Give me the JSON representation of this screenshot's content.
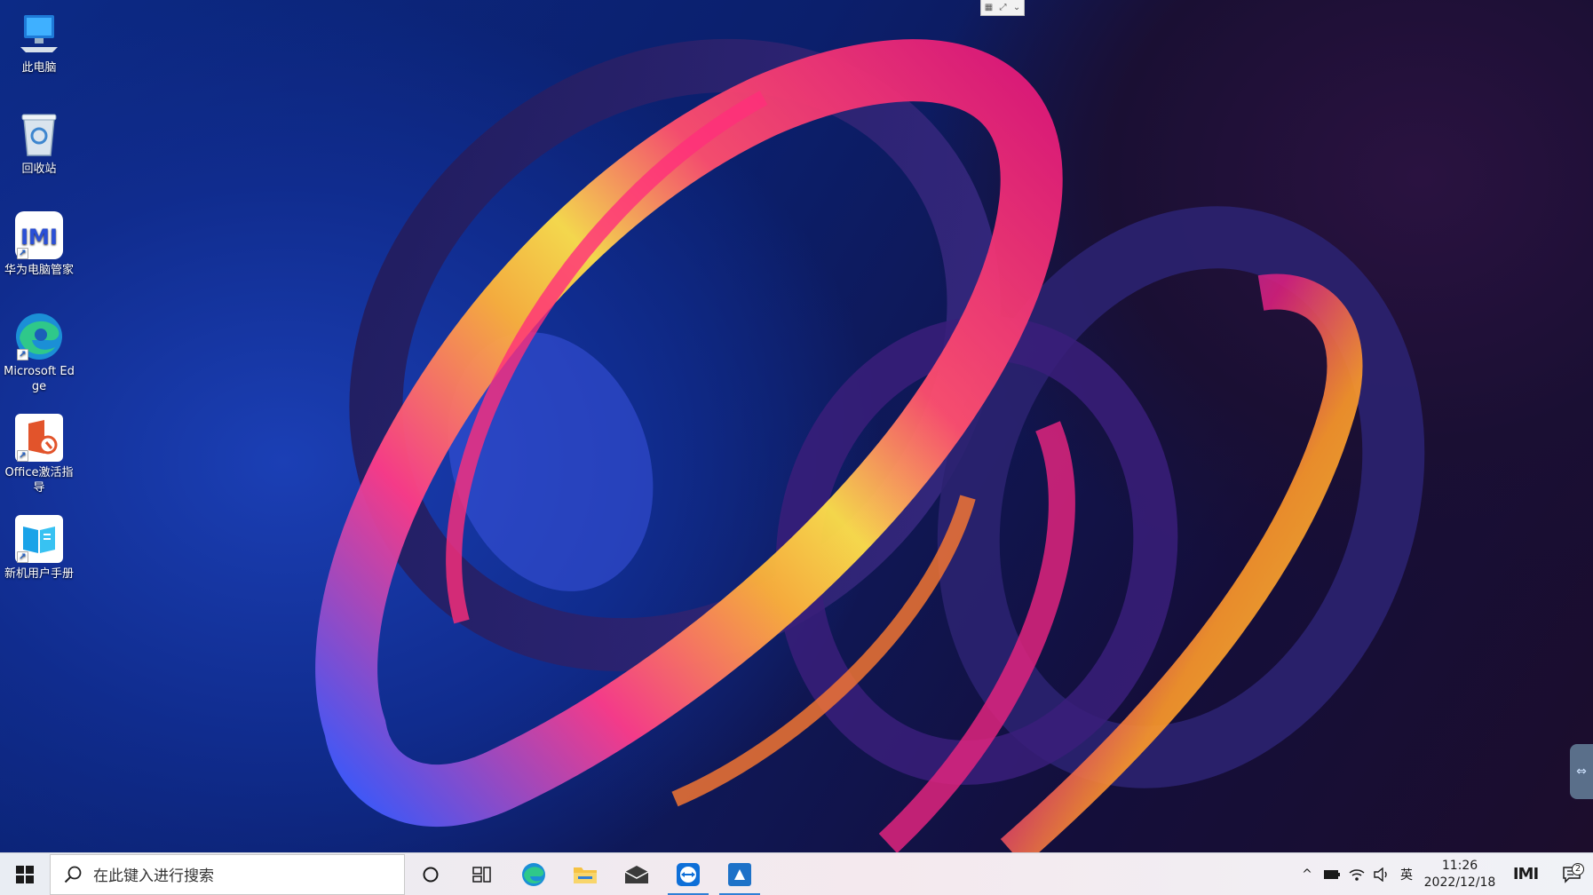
{
  "desktop": {
    "icons": [
      {
        "label": "此电脑",
        "icon": "computer-icon"
      },
      {
        "label": "回收站",
        "icon": "recycle-bin-icon"
      },
      {
        "label": "华为电脑管家",
        "icon": "huawei-pc-manager-icon"
      },
      {
        "label": "Microsoft Edge",
        "icon": "edge-icon"
      },
      {
        "label": "Office激活指导",
        "icon": "office-activation-icon"
      },
      {
        "label": "新机用户手册",
        "icon": "user-manual-icon"
      }
    ]
  },
  "taskbar": {
    "search_placeholder": "在此键入进行搜索",
    "pinned": [
      "cortana-icon",
      "task-view-icon",
      "edge-icon",
      "file-explorer-icon",
      "mail-icon",
      "teamviewer-icon",
      "quick-assist-icon"
    ],
    "tray": {
      "ime": "英",
      "time": "11:26",
      "date": "2022/12/18",
      "notification_count": "2"
    }
  },
  "colors": {
    "taskbar_bg": "#eef0f5",
    "active_indicator": "#2f7fd6",
    "wallpaper_base": "#0c2a86"
  }
}
